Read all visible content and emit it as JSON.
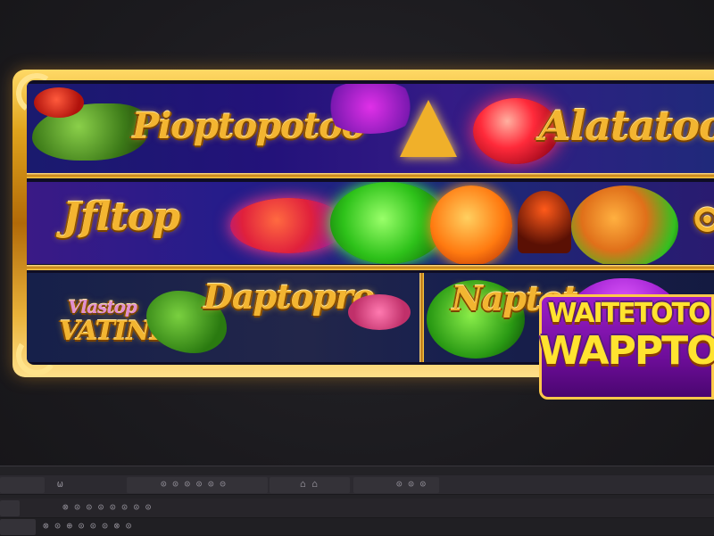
{
  "reels": {
    "row1": {
      "word_left": "Pioptopotoo",
      "word_right": "Alatatoo"
    },
    "row2": {
      "word_left": "Jfltop"
    },
    "row3": {
      "word_left_small": "Vlastop",
      "word_left": "VATINE",
      "word_mid": "Daptopro",
      "word_right": "Naptotoo"
    }
  },
  "badge": {
    "line1": "WAITETOTO",
    "line2": "WAPPTO"
  },
  "hud": {
    "row1": [
      "ω",
      "⊙ ⊙ ⊙ ⊙ ⊙ ⊝",
      "⌂ ⌂",
      "⊙ ⊙ ⊙"
    ],
    "row2": [
      "⊗ ⊙ ⊙ ⊙ ⊙ ⊙ ⊙ ⊙"
    ],
    "row3": [
      "⊗ ⊙ ⊕ ⊙ ⊙ ⊙ ⊗ ⊙"
    ]
  }
}
